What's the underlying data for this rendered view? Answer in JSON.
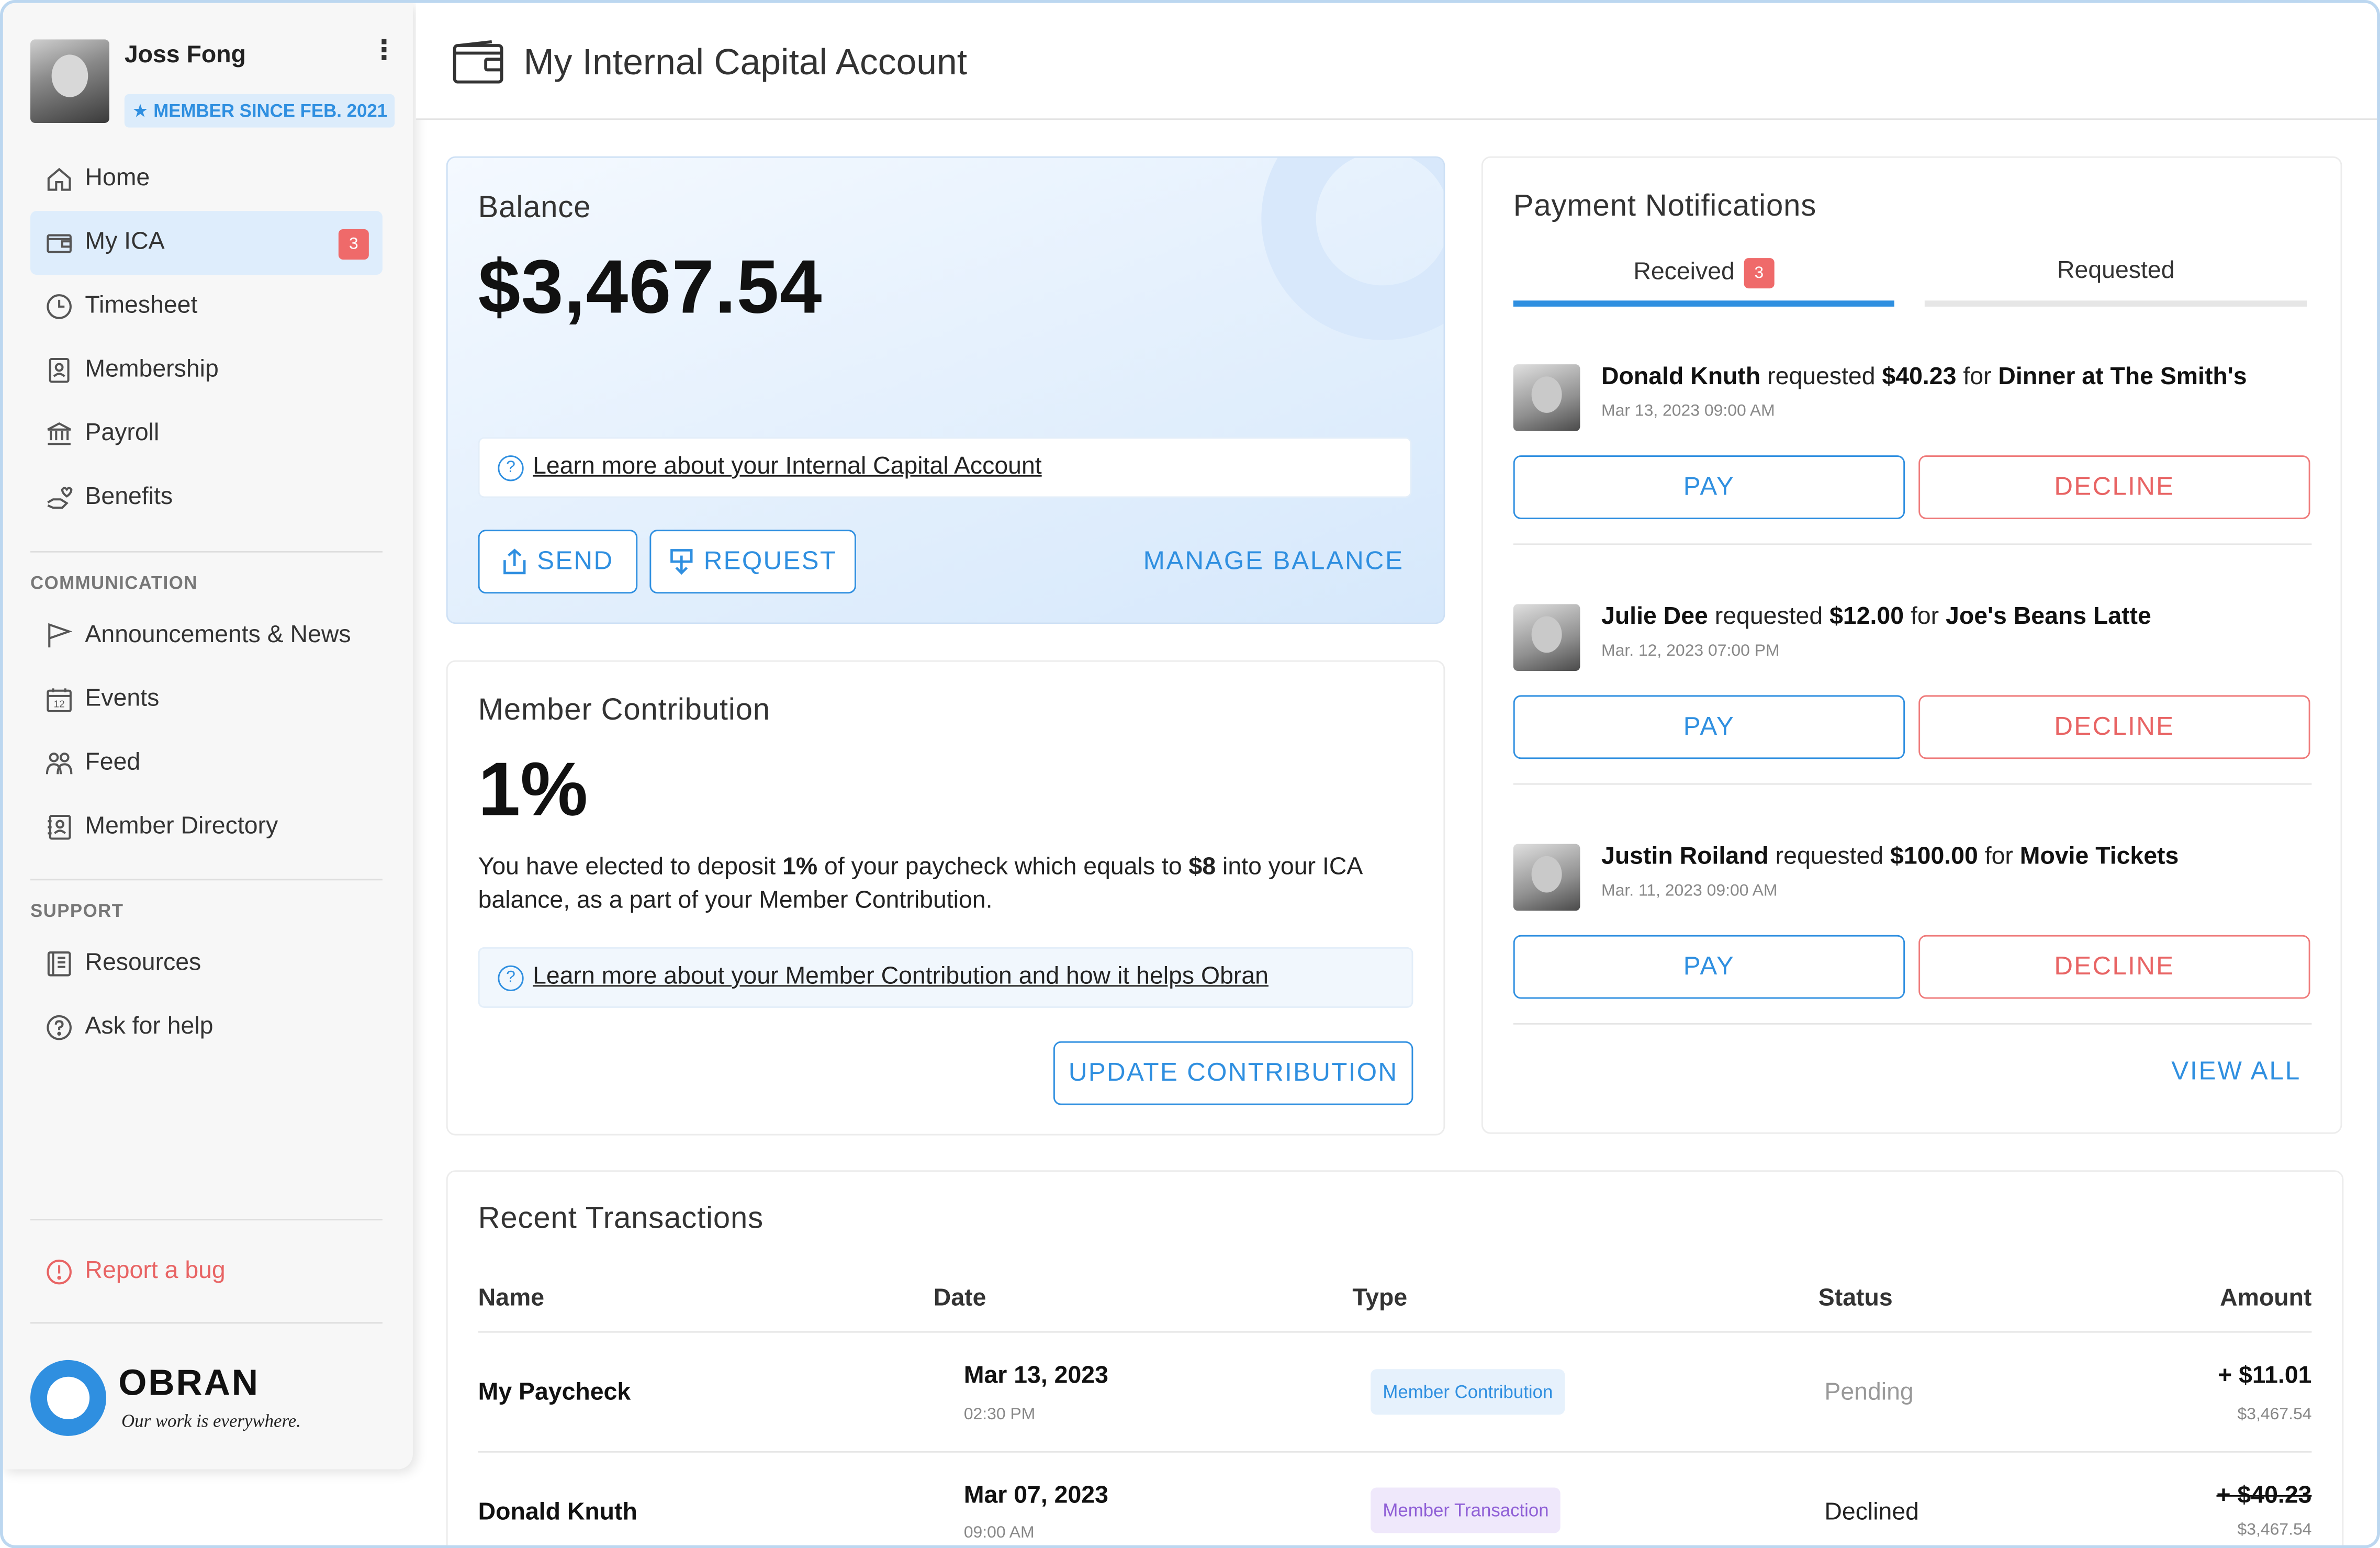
{
  "profile": {
    "name": "Joss Fong",
    "badge": "MEMBER SINCE FEB. 2021"
  },
  "sidebar": {
    "main_items": [
      {
        "label": "Home",
        "icon": "home-icon"
      },
      {
        "label": "My ICA",
        "icon": "wallet-icon",
        "badge": "3"
      },
      {
        "label": "Timesheet",
        "icon": "clock-icon"
      },
      {
        "label": "Membership",
        "icon": "id-card-icon"
      },
      {
        "label": "Payroll",
        "icon": "bank-icon"
      },
      {
        "label": "Benefits",
        "icon": "hand-heart-icon"
      }
    ],
    "communication_label": "COMMUNICATION",
    "communication_items": [
      {
        "label": "Announcements & News",
        "icon": "flag-icon"
      },
      {
        "label": "Events",
        "icon": "calendar-icon"
      },
      {
        "label": "Feed",
        "icon": "people-icon"
      },
      {
        "label": "Member Directory",
        "icon": "contact-book-icon"
      }
    ],
    "support_label": "SUPPORT",
    "support_items": [
      {
        "label": "Resources",
        "icon": "document-icon"
      },
      {
        "label": "Ask for help",
        "icon": "question-icon"
      }
    ],
    "report_bug": "Report a bug"
  },
  "brand": {
    "name": "OBRAN",
    "tagline": "Our work is everywhere."
  },
  "header": {
    "title": "My Internal Capital Account"
  },
  "balance": {
    "label": "Balance",
    "amount": "$3,467.54",
    "learn_more": "Learn more about your Internal Capital Account",
    "send": "SEND",
    "request": "REQUEST",
    "manage": "MANAGE BALANCE"
  },
  "contribution": {
    "title": "Member Contribution",
    "value": "1%",
    "desc_1": "You have elected to deposit ",
    "desc_pct": "1%",
    "desc_2": " of your paycheck which equals to ",
    "desc_amt": "$8",
    "desc_3": " into your ICA balance, as a part of your Member Contribution.",
    "learn_more": "Learn more about your Member Contribution and how it helps Obran",
    "update": "UPDATE CONTRIBUTION"
  },
  "payments": {
    "title": "Payment Notifications",
    "tab_received": "Received",
    "tab_received_badge": "3",
    "tab_requested": "Requested",
    "pay_label": "PAY",
    "decline_label": "DECLINE",
    "view_all": "VIEW ALL",
    "items": [
      {
        "name": "Donald Knuth",
        "verb": "requested",
        "amount": "$40.23",
        "prep": "for",
        "item": "Dinner at The Smith's",
        "time": "Mar 13, 2023 09:00 AM"
      },
      {
        "name": "Julie Dee",
        "verb": "requested",
        "amount": "$12.00",
        "prep": "for",
        "item": "Joe's Beans Latte",
        "time": "Mar. 12, 2023 07:00 PM"
      },
      {
        "name": "Justin Roiland",
        "verb": "requested",
        "amount": "$100.00",
        "prep": "for",
        "item": "Movie Tickets",
        "time": "Mar. 11, 2023 09:00 AM"
      }
    ]
  },
  "transactions": {
    "title": "Recent Transactions",
    "columns": [
      "Name",
      "Date",
      "Type",
      "Status",
      "Amount"
    ],
    "rows": [
      {
        "name": "My Paycheck",
        "date": "Mar 13, 2023",
        "time": "02:30 PM",
        "type": "Member Contribution",
        "status": "Pending",
        "amount": "+ $11.01",
        "balance": "$3,467.54"
      },
      {
        "name": "Donald Knuth",
        "date": "Mar 07, 2023",
        "time": "09:00 AM",
        "type": "Member Transaction",
        "status": "Declined",
        "amount": "+ $40.23",
        "balance": "$3,467.54"
      }
    ]
  },
  "colors": {
    "accent": "#2f8fe0",
    "danger": "#e86464",
    "badge": "#ef6a6a",
    "purple": "#8f5fd6"
  }
}
